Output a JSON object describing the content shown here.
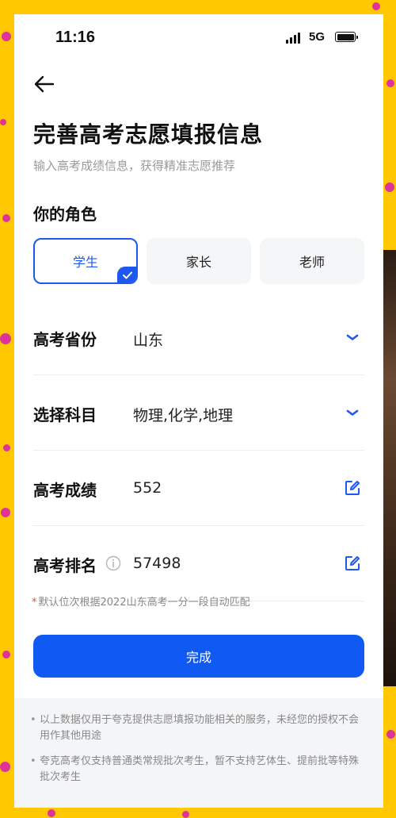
{
  "status_bar": {
    "time": "11:16",
    "network": "5G"
  },
  "icons": {
    "back": "arrow-left-icon",
    "dropdown": "chevron-down-icon",
    "edit": "edit-icon",
    "info": "info-icon",
    "check": "check-icon"
  },
  "colors": {
    "accent": "#1E58F0",
    "button": "#1059F2",
    "background": "#FFC800"
  },
  "header": {
    "title": "完善高考志愿填报信息",
    "subtitle": "输入高考成绩信息，获得精准志愿推荐"
  },
  "role": {
    "label": "你的角色",
    "options": [
      {
        "label": "学生",
        "selected": true
      },
      {
        "label": "家长",
        "selected": false
      },
      {
        "label": "老师",
        "selected": false
      }
    ]
  },
  "form": {
    "province": {
      "label": "高考省份",
      "value": "山东"
    },
    "subjects": {
      "label": "选择科目",
      "value": "物理,化学,地理"
    },
    "score": {
      "label": "高考成绩",
      "value": "552"
    },
    "rank": {
      "label": "高考排名",
      "value": "57498"
    }
  },
  "hint": {
    "star": "*",
    "text": "默认位次根据2022山东高考一分一段自动匹配"
  },
  "submit_label": "完成",
  "footer": {
    "notes": [
      "以上数据仅用于夸克提供志愿填报功能相关的服务，未经您的授权不会用作其他用途",
      "夸克高考仅支持普通类常规批次考生，暂不支持艺体生、提前批等特殊批次考生"
    ]
  }
}
